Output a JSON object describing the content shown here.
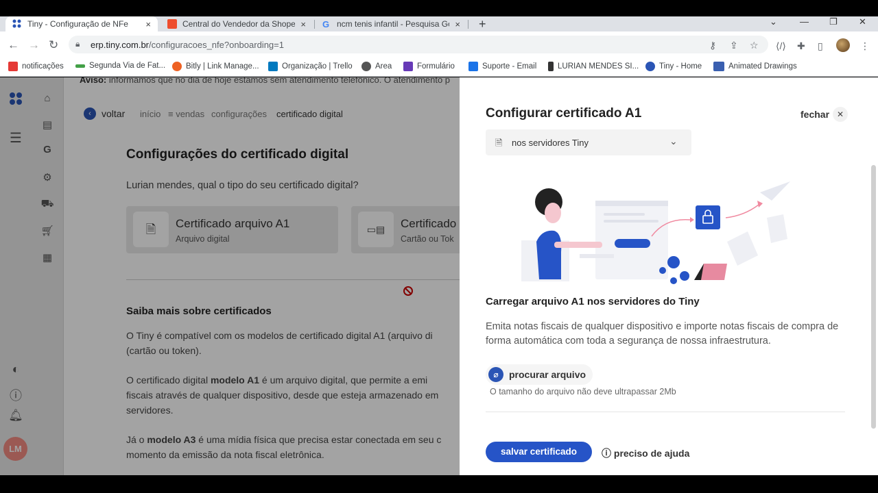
{
  "browser": {
    "tabs": [
      {
        "title": "Tiny - Configuração de NFe",
        "close": "×"
      },
      {
        "title": "Central do Vendedor da Shopee",
        "close": "×"
      },
      {
        "title": "ncm tenis infantil - Pesquisa Goo",
        "close": "×"
      }
    ],
    "new_tab": "+",
    "window_controls": [
      "⌄",
      "—",
      "❐",
      "✕"
    ],
    "url_domain": "erp.tiny.com.br",
    "url_path": "/configuracoes_nfe?onboarding=1",
    "bookmarks": [
      {
        "label": "notificações",
        "color": "#e53935"
      },
      {
        "label": "Segunda Via de Fat...",
        "color": "#43a047"
      },
      {
        "label": "Bitly | Link Manage...",
        "color": "#ee6123"
      },
      {
        "label": "Organização | Trello",
        "color": "#0079bf"
      },
      {
        "label": "Area",
        "color": "#555555"
      },
      {
        "label": "Formulário",
        "color": "#673ab7"
      },
      {
        "label": "Suporte - Email",
        "color": "#1a73e8"
      },
      {
        "label": "LURIAN MENDES SI...",
        "color": "#333333"
      },
      {
        "label": "Tiny - Home",
        "color": "#2b55b5"
      },
      {
        "label": "Animated Drawings",
        "color": "#3a5fb0"
      }
    ]
  },
  "app": {
    "notice_bold": "Aviso:",
    "notice_text": " informamos que no dia de hoje estamos sem atendimento telefônico. O atendimento p",
    "back_label": "voltar",
    "breadcrumb": [
      "início",
      "≡ vendas",
      "configurações",
      "certificado digital"
    ],
    "page_title": "Configurações do certificado digital",
    "question": "Lurian mendes, qual o tipo do seu certificado digital?",
    "cards": [
      {
        "title": "Certificado arquivo A1",
        "subtitle": "Arquivo digital"
      },
      {
        "title": "Certificado",
        "subtitle": "Cartão ou Tok"
      }
    ],
    "learn_title": "Saiba mais sobre certificados",
    "para1_l1": "O Tiny é compatível com os modelos de certificado digital A1 (arquivo di",
    "para1_l2": "(cartão ou token).",
    "para2_a": "O certificado digital ",
    "para2_b": "modelo A1",
    "para2_c": " é um arquivo digital, que permite a emi",
    "para2_l2": "fiscais através de qualquer dispositivo, desde que esteja armazenado em",
    "para2_l3": "servidores.",
    "para3_a": "Já o ",
    "para3_b": "modelo A3",
    "para3_c": " é uma mídia física que precisa estar conectada em seu c",
    "para3_l2": "momento da emissão da nota fiscal eletrônica.",
    "user_initials": "LM"
  },
  "panel": {
    "title": "Configurar certificado A1",
    "close_label": "fechar",
    "select_value": "nos servidores Tiny",
    "subtitle": "Carregar arquivo A1 nos servidores do Tiny",
    "description": "Emita notas fiscais de qualquer dispositivo e importe notas fiscais de compra de forma automática com toda a segurança de nossa infraestrutura.",
    "upload_label": "procurar arquivo",
    "upload_hint": "O tamanho do arquivo não deve ultrapassar 2Mb",
    "save_label": "salvar certificado",
    "help_label": "preciso de ajuda",
    "accent": "#2654c7"
  }
}
